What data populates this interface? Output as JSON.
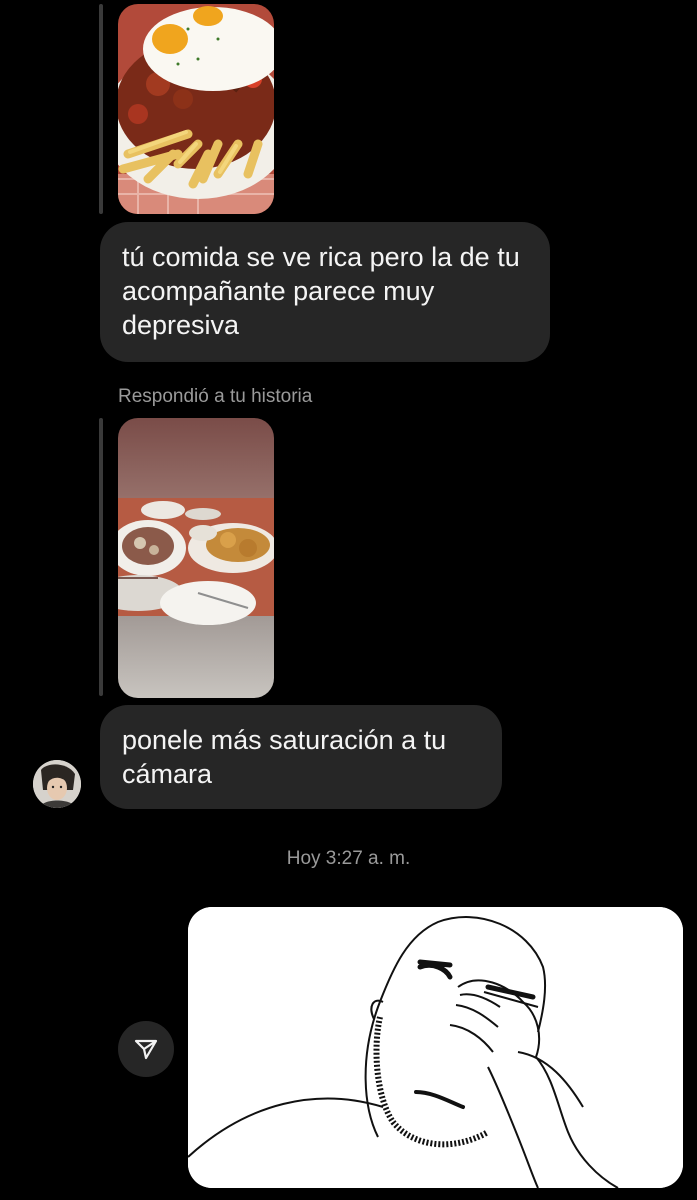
{
  "thread": {
    "messages": [
      {
        "kind": "story_reply",
        "text": "tú comida se ve rica pero la de tu acompañante parece muy depresiva",
        "story_image": "plate-of-fries-with-fried-egg"
      },
      {
        "kind": "story_reply",
        "header": "Respondió a tu historia",
        "text": "ponele más saturación a tu cámara",
        "story_image": "restaurant-table-dishes"
      }
    ],
    "timestamp": "Hoy 3:27 a. m.",
    "sent_image": "facepalm-meme-drawing",
    "share_icon": "paper-plane-icon"
  },
  "colors": {
    "background": "#000000",
    "bubble": "#262626",
    "meta_text": "#9a9a9a",
    "text": "#f4f4f4"
  }
}
